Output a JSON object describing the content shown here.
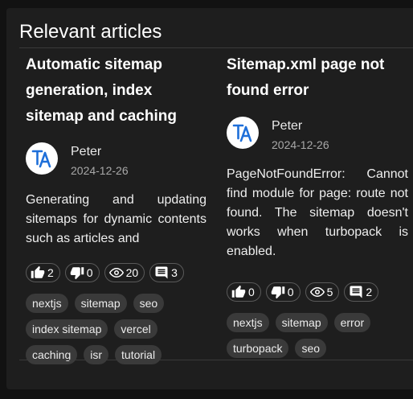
{
  "section": {
    "title": "Relevant articles"
  },
  "articles": [
    {
      "title": "Automatic sitemap generation, index sitemap and caching",
      "author": "Peter",
      "date": "2024-12-26",
      "description": "Generating and updating sitemaps for dynamic contents such as articles and",
      "stats": {
        "likes": "2",
        "dislikes": "0",
        "views": "20",
        "comments": "3"
      },
      "tags": [
        "nextjs",
        "sitemap",
        "seo",
        "index sitemap",
        "vercel",
        "caching",
        "isr",
        "tutorial"
      ]
    },
    {
      "title": "Sitemap.xml page not found error",
      "author": "Peter",
      "date": "2024-12-26",
      "description": "PageNotFoundError: Cannot find module for page: route not found. The sitemap doesn't works when turbopack is enabled.",
      "stats": {
        "likes": "0",
        "dislikes": "0",
        "views": "5",
        "comments": "2"
      },
      "tags": [
        "nextjs",
        "sitemap",
        "error",
        "turbopack",
        "seo"
      ]
    }
  ],
  "avatar": {
    "monogram": "TA",
    "color": "#1e6fd9"
  },
  "icons": [
    "thumb-up-icon",
    "thumb-down-icon",
    "eye-icon",
    "comment-icon"
  ]
}
